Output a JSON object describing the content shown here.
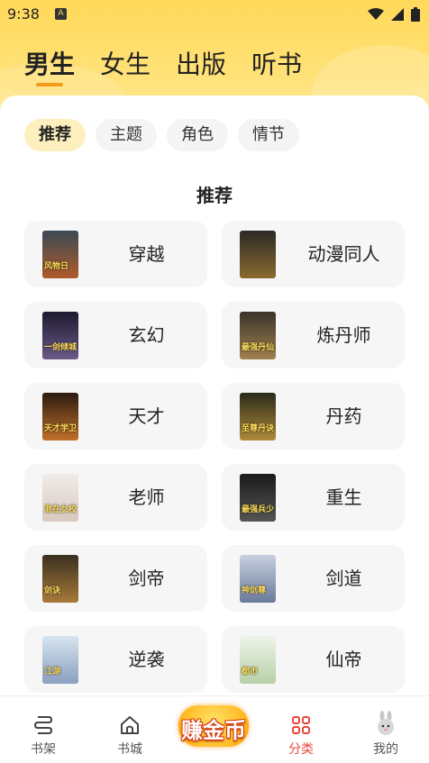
{
  "status": {
    "time": "9:38",
    "app_icon_letter": "A"
  },
  "gender_tabs": [
    {
      "label": "男生",
      "active": true
    },
    {
      "label": "女生",
      "active": false
    },
    {
      "label": "出版",
      "active": false
    },
    {
      "label": "听书",
      "active": false
    }
  ],
  "chips": [
    {
      "label": "推荐",
      "active": true
    },
    {
      "label": "主题",
      "active": false
    },
    {
      "label": "角色",
      "active": false
    },
    {
      "label": "情节",
      "active": false
    }
  ],
  "section_title": "推荐",
  "categories": [
    {
      "label": "穿越",
      "cover_text": "风物日",
      "cover_colors": [
        "#3a4a55",
        "#b05a2a"
      ]
    },
    {
      "label": "动漫同人",
      "cover_text": "",
      "cover_colors": [
        "#2b2a25",
        "#8a6a30"
      ]
    },
    {
      "label": "玄幻",
      "cover_text": "一剑倾城",
      "cover_colors": [
        "#1e1a2e",
        "#6a5a8a"
      ]
    },
    {
      "label": "炼丹师",
      "cover_text": "最强丹仙",
      "cover_colors": [
        "#3a3428",
        "#a08050"
      ]
    },
    {
      "label": "天才",
      "cover_text": "天才学卫",
      "cover_colors": [
        "#2a1a10",
        "#c0702a"
      ]
    },
    {
      "label": "丹药",
      "cover_text": "至尊丹诀",
      "cover_colors": [
        "#2a2a1a",
        "#b08a3a"
      ]
    },
    {
      "label": "老师",
      "cover_text": "混在女校",
      "cover_colors": [
        "#f0ece8",
        "#d8c8c0"
      ]
    },
    {
      "label": "重生",
      "cover_text": "最强兵少",
      "cover_colors": [
        "#1a1a1a",
        "#555555"
      ]
    },
    {
      "label": "剑帝",
      "cover_text": "剑诀",
      "cover_colors": [
        "#3a3020",
        "#a87a3a"
      ]
    },
    {
      "label": "剑道",
      "cover_text": "神剑尊",
      "cover_colors": [
        "#c8d0e0",
        "#6a7a9a"
      ]
    },
    {
      "label": "逆袭",
      "cover_text": "江湖",
      "cover_colors": [
        "#d8e4f0",
        "#8aa0c0"
      ]
    },
    {
      "label": "仙帝",
      "cover_text": "都市",
      "cover_colors": [
        "#eef4e8",
        "#b8d0a8"
      ]
    }
  ],
  "bottom_nav": [
    {
      "label": "书架",
      "icon": "bookshelf-icon",
      "active": false
    },
    {
      "label": "书城",
      "icon": "home-icon",
      "active": false
    },
    {
      "label": "分类",
      "icon": "category-grid-icon",
      "active": true
    },
    {
      "label": "我的",
      "icon": "rabbit-avatar-icon",
      "active": false
    }
  ],
  "earn_badge": {
    "label": "赚金币"
  },
  "colors": {
    "header_yellow": "#ffd95a",
    "active_chip_bg": "#fdf0be",
    "tab_underline": "#f59a1a",
    "nav_active": "#e8483a"
  }
}
